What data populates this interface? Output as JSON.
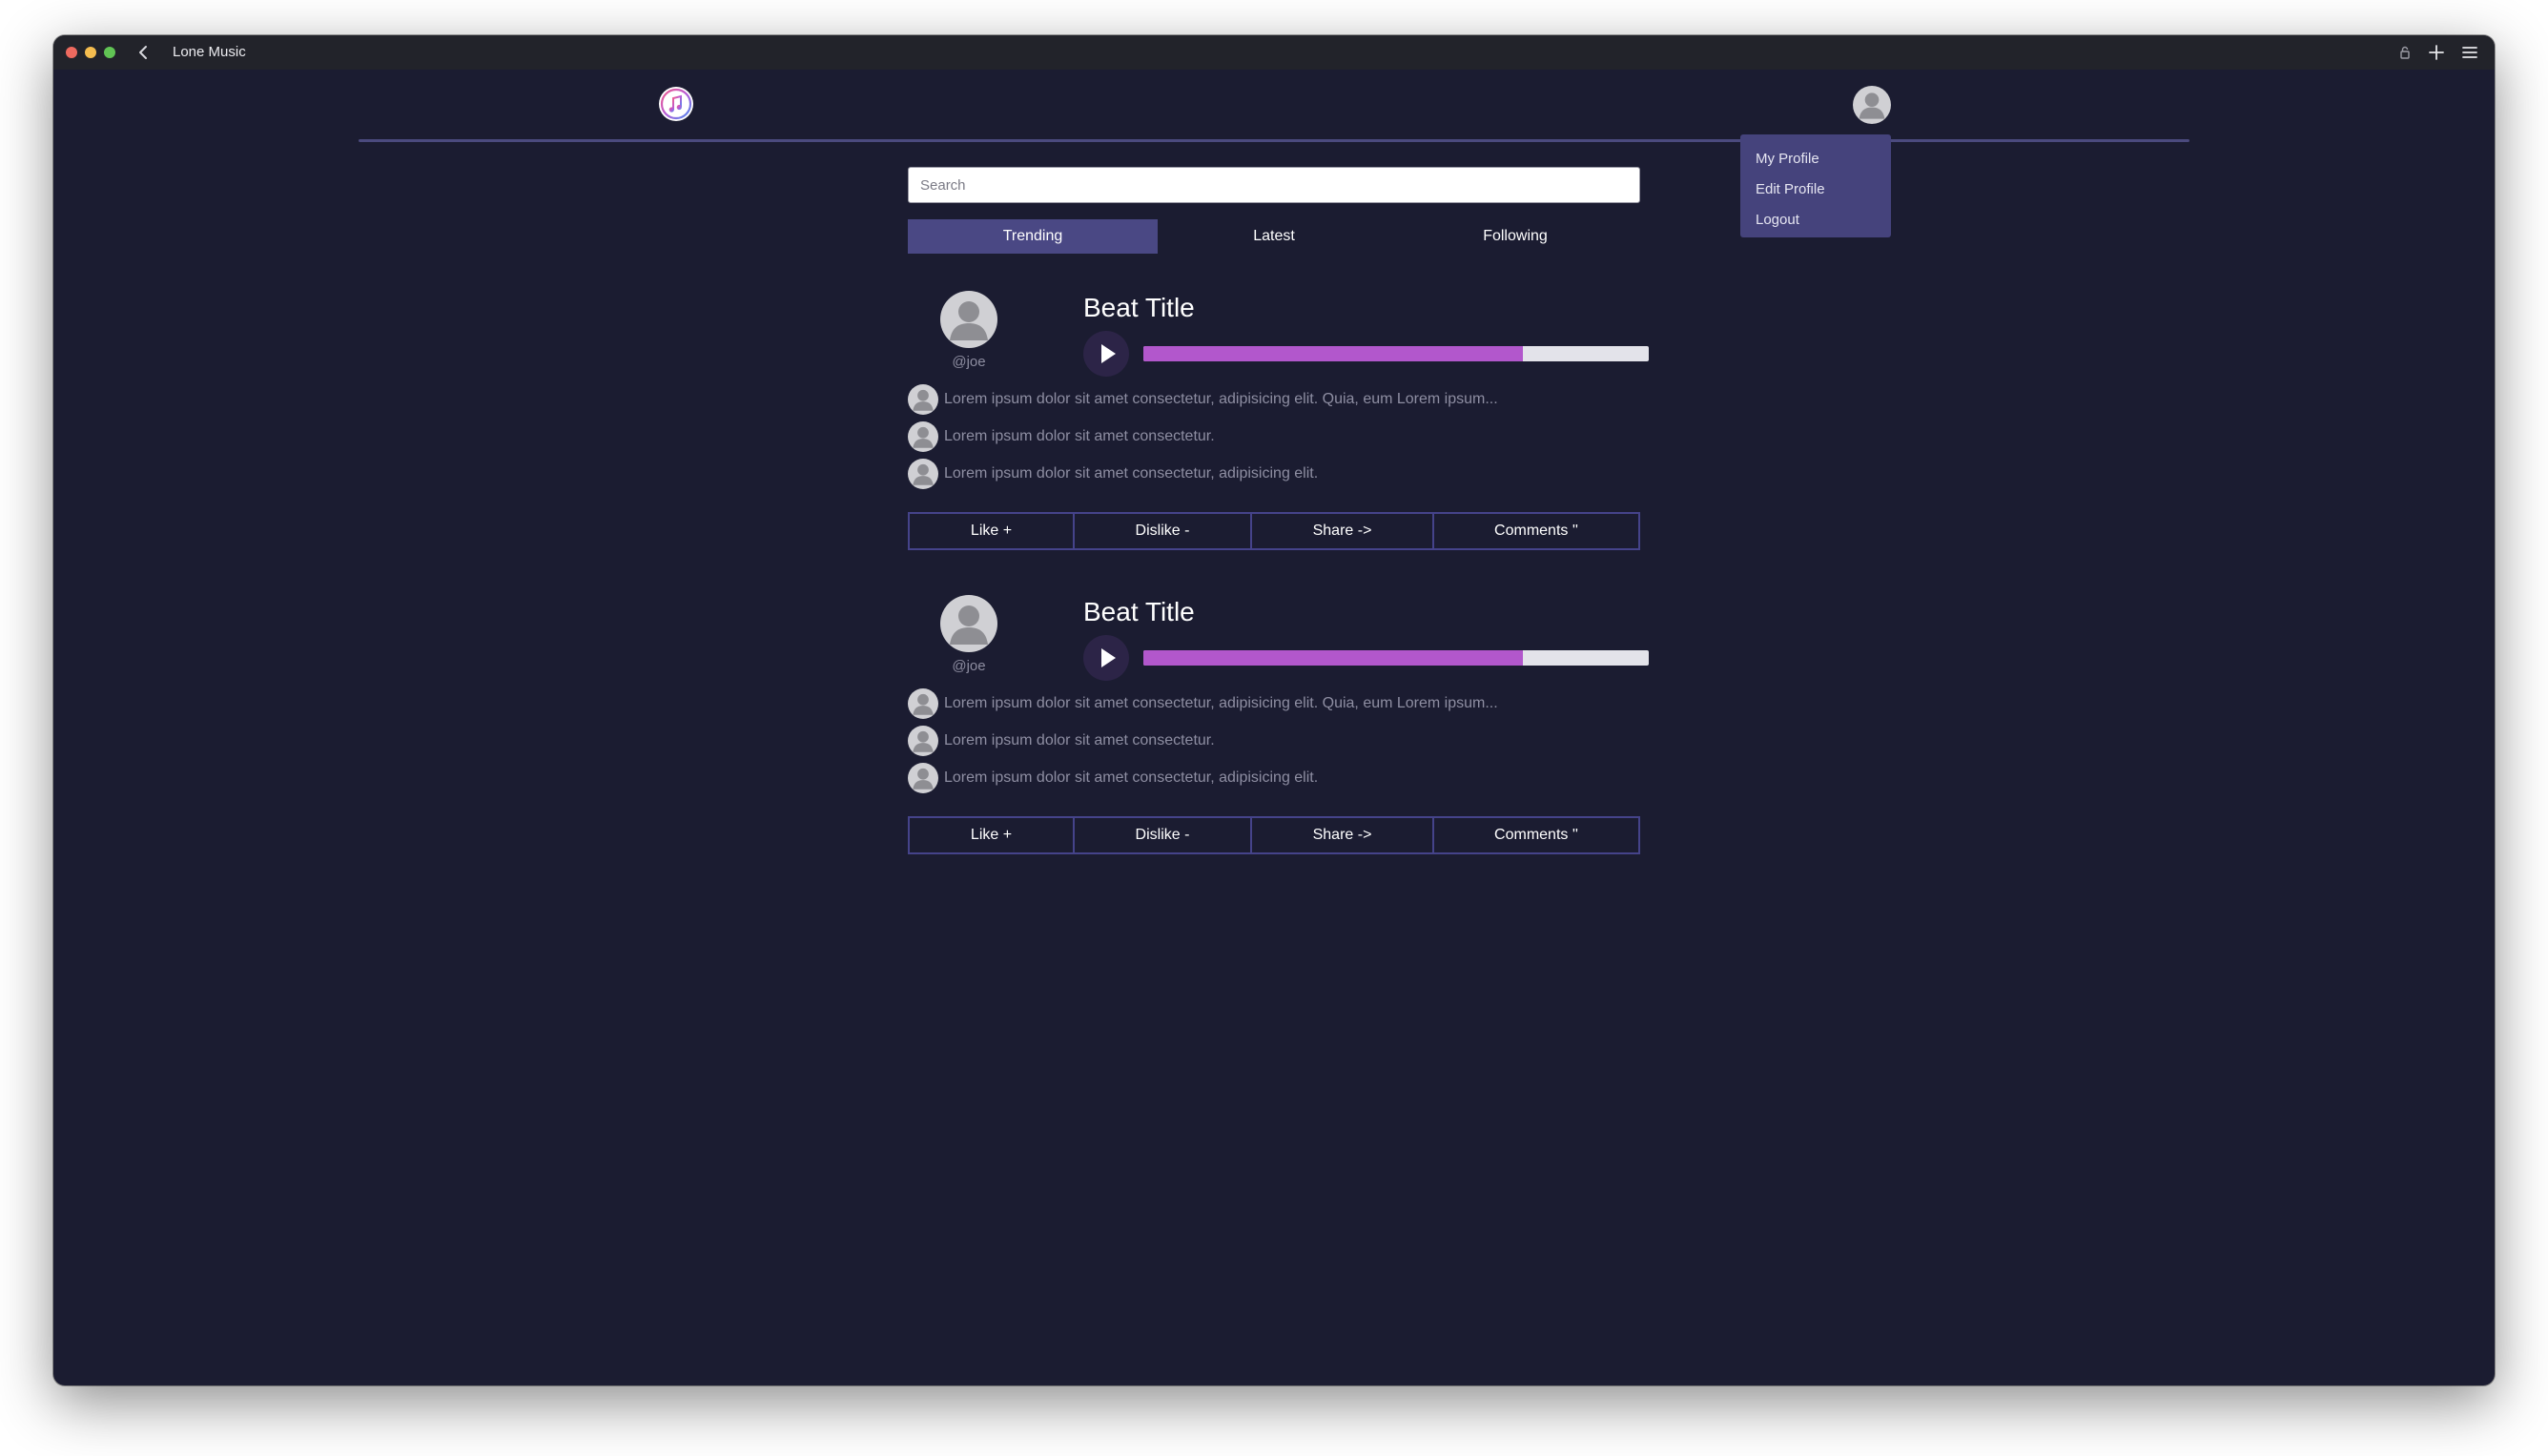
{
  "window": {
    "title": "Lone Music",
    "back_icon": "chevron-left-icon",
    "right_icons": [
      "lock-icon",
      "plus-icon",
      "menu-icon"
    ]
  },
  "header": {
    "logo_icon": "music-note-icon",
    "profile_avatar_icon": "user-avatar-icon"
  },
  "profile_menu": {
    "items": [
      "My Profile",
      "Edit Profile",
      "Logout"
    ]
  },
  "search": {
    "placeholder": "Search",
    "value": ""
  },
  "tabs": [
    {
      "label": "Trending",
      "active": true
    },
    {
      "label": "Latest",
      "active": false
    },
    {
      "label": "Following",
      "active": false
    }
  ],
  "posts": [
    {
      "handle": "@joe",
      "title": "Beat Title",
      "progress": 0.75,
      "comments": [
        "Lorem ipsum dolor sit amet consectetur, adipisicing elit. Quia, eum Lorem ipsum...",
        "Lorem ipsum dolor sit amet consectetur.",
        "Lorem ipsum dolor sit amet consectetur, adipisicing elit."
      ],
      "actions": [
        "Like +",
        "Dislike -",
        "Share ->",
        "Comments ''"
      ]
    },
    {
      "handle": "@joe",
      "title": "Beat Title",
      "progress": 0.75,
      "comments": [
        "Lorem ipsum dolor sit amet consectetur, adipisicing elit. Quia, eum Lorem ipsum...",
        "Lorem ipsum dolor sit amet consectetur.",
        "Lorem ipsum dolor sit amet consectetur, adipisicing elit."
      ],
      "actions": [
        "Like +",
        "Dislike -",
        "Share ->",
        "Comments ''"
      ]
    }
  ],
  "colors": {
    "background": "#1b1c31",
    "accent": "#4a4884",
    "progress": "#b257cc",
    "menu": "#45437c"
  }
}
